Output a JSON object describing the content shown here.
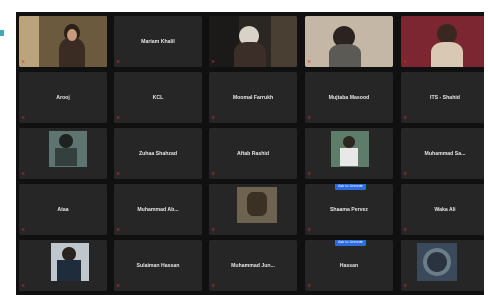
{
  "colors": {
    "background": "#101010",
    "tile": "#262626",
    "active_border": "#d2c637",
    "muted": "#e02b2b",
    "badge": "#2d6be0"
  },
  "tiles": [
    {
      "name": "",
      "label": "",
      "video": true
    },
    {
      "name": "Mariam Khalil",
      "label": "",
      "video": false
    },
    {
      "name": "",
      "label": "",
      "video": true
    },
    {
      "name": "",
      "label": "",
      "video": true
    },
    {
      "name": "",
      "label": "",
      "video": true
    },
    {
      "name": "Arooj",
      "label": "",
      "video": false
    },
    {
      "name": "KCL",
      "label": "",
      "video": false
    },
    {
      "name": "Moomal Farrukh",
      "label": "",
      "video": false
    },
    {
      "name": "Mujtaba Masood",
      "label": "",
      "video": false
    },
    {
      "name": "ITS - Shahid",
      "label": "",
      "video": false
    },
    {
      "name": "",
      "label": "",
      "video": true
    },
    {
      "name": "Zuhaa Shahzad",
      "label": "",
      "video": false
    },
    {
      "name": "Aftab Rashid",
      "label": "",
      "video": false
    },
    {
      "name": "",
      "label": "",
      "video": true
    },
    {
      "name": "Muhammad Sa...",
      "label": "",
      "video": false
    },
    {
      "name": "Ataa",
      "label": "",
      "video": false
    },
    {
      "name": "Muhammad Ab...",
      "label": "",
      "video": false
    },
    {
      "name": "",
      "label": "",
      "video": true
    },
    {
      "name": "Shaama Pervez",
      "label": "",
      "video": false,
      "badge": "Ask to Unmute"
    },
    {
      "name": "Waka Ali",
      "label": "",
      "video": false
    },
    {
      "name": "",
      "label": "",
      "video": true
    },
    {
      "name": "Sulaiman Hassan",
      "label": "",
      "video": false
    },
    {
      "name": "Muhammad Jun...",
      "label": "",
      "video": false
    },
    {
      "name": "Hassan",
      "label": "",
      "video": false,
      "badge": "Ask to Unmute"
    },
    {
      "name": "",
      "label": "",
      "video": true
    }
  ]
}
